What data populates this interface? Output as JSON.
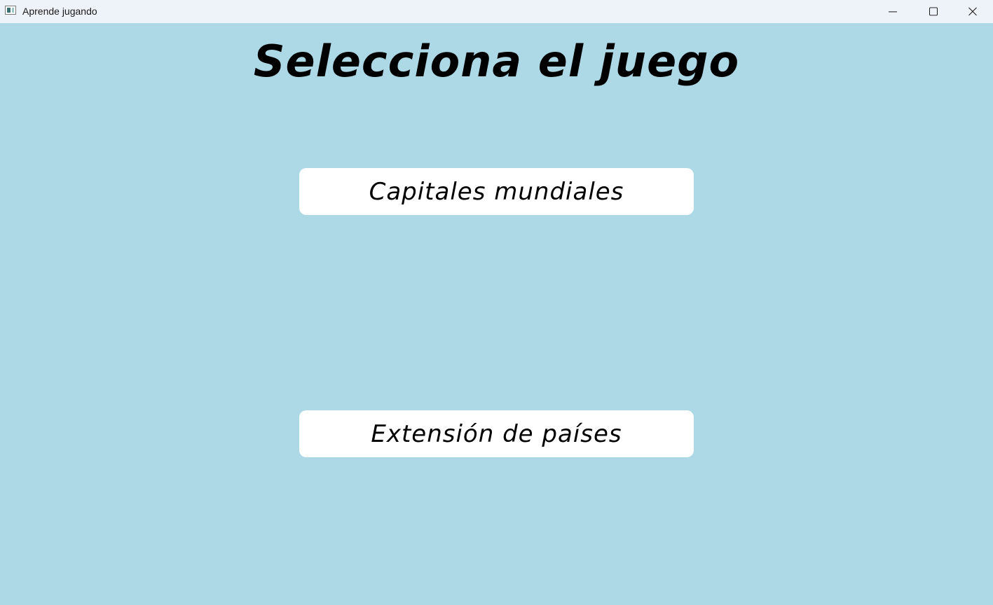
{
  "window": {
    "title": "Aprende jugando",
    "background_color": "#add8e6",
    "icons": {
      "app": "app-window-icon",
      "minimize": "minimize-icon",
      "maximize": "maximize-icon",
      "close": "close-icon"
    }
  },
  "main": {
    "heading": "Selecciona el juego",
    "buttons": [
      {
        "label": "Capitales mundiales"
      },
      {
        "label": "Extensión de países"
      }
    ]
  }
}
